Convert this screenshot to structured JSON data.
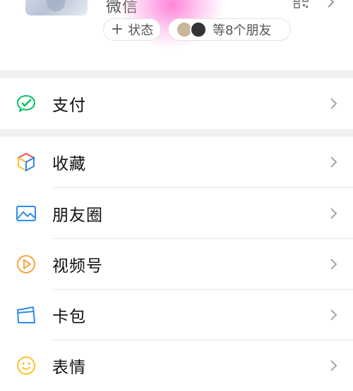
{
  "profile": {
    "name_partial": "微信",
    "status_label": "状态",
    "friends_label": "等8个朋友"
  },
  "menu": {
    "pay": "支付",
    "favorites": "收藏",
    "moments": "朋友圈",
    "channels": "视频号",
    "cards": "卡包",
    "stickers": "表情"
  },
  "icons": {
    "pay": "wechat-pay-icon",
    "favorites": "cube-icon",
    "moments": "picture-icon",
    "channels": "play-circle-icon",
    "cards": "card-icon",
    "stickers": "smiley-icon",
    "qr": "qr-code-icon",
    "chevron": "chevron-right-icon"
  },
  "colors": {
    "pay_green": "#07C160",
    "channels_orange": "#F5A646",
    "moments_blue": "#2F8BE6",
    "cards_blue": "#2F8BE6",
    "stickers_yellow": "#F6C32B",
    "favorites_multi": "#E84E4E"
  }
}
